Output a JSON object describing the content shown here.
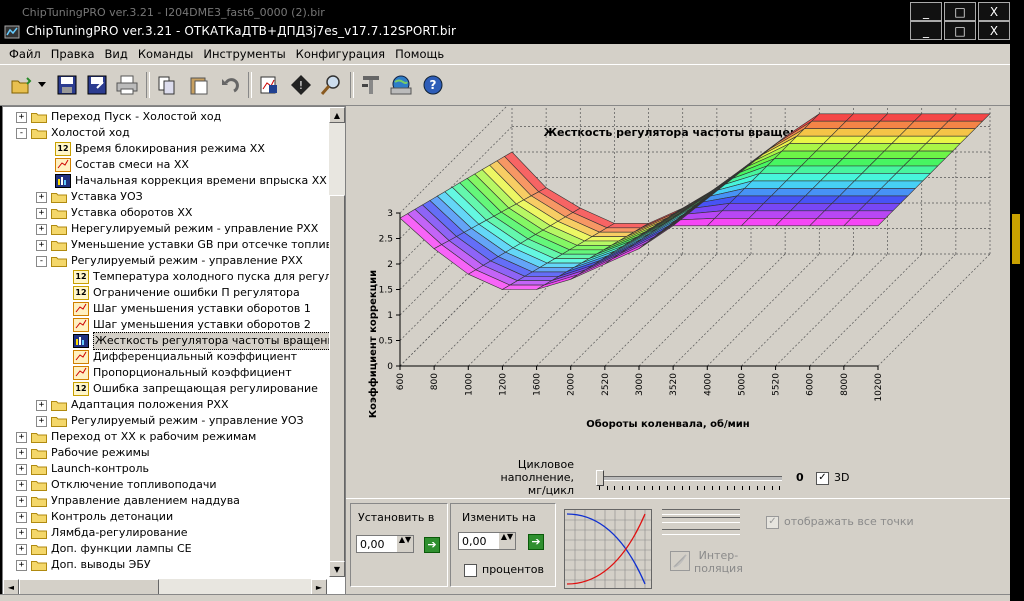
{
  "window": {
    "ghost_title": "ChipTuningPRO ver.3.21 - I204DME3_fast6_0000 (2).bir",
    "title": "ChipTuningPRO ver.3.21 - ОТКАТКаДТВ+ДПДЗj7es_v17.7.12SPORT.bir",
    "buttons": {
      "minimize": "_",
      "maximize": "□",
      "close": "X"
    }
  },
  "menu": [
    "Файл",
    "Правка",
    "Вид",
    "Команды",
    "Инструменты",
    "Конфигурация",
    "Помощь"
  ],
  "toolbar": {
    "icons": [
      "open-icon",
      "save-icon",
      "save-as-icon",
      "print-icon",
      "copy-icon",
      "paste-icon",
      "undo-icon",
      "compare-icon",
      "info-icon",
      "zoom-icon",
      "tools-icon",
      "network-icon",
      "help-icon"
    ]
  },
  "tree": {
    "items": [
      {
        "label": "Переход Пуск - Холостой ход",
        "type": "folder",
        "level": 0,
        "expander": "+"
      },
      {
        "label": "Холостой ход",
        "type": "folder",
        "level": 0,
        "expander": "−"
      },
      {
        "label": "Время блокирования режима ХХ",
        "type": "12",
        "level": 1
      },
      {
        "label": "Состав смеси на ХХ",
        "type": "chart",
        "level": 1
      },
      {
        "label": "Начальная коррекция времени впрыска ХХ",
        "type": "3d",
        "level": 1
      },
      {
        "label": "Уставка УОЗ",
        "type": "folder",
        "level": 1,
        "expander": "+"
      },
      {
        "label": "Уставка оборотов ХХ",
        "type": "folder",
        "level": 1,
        "expander": "+"
      },
      {
        "label": "Нерегулируемый режим - управление РХХ",
        "type": "folder",
        "level": 1,
        "expander": "+"
      },
      {
        "label": "Уменьшение уставки GB при отсечке топливо",
        "type": "folder",
        "level": 1,
        "expander": "+"
      },
      {
        "label": "Регулируемый режим - управление РХХ",
        "type": "folder",
        "level": 1,
        "expander": "−"
      },
      {
        "label": "Температура холодного пуска для регулир",
        "type": "12",
        "level": 2
      },
      {
        "label": "Ограничение ошибки П регулятора",
        "type": "12",
        "level": 2
      },
      {
        "label": "Шаг уменьшения уставки оборотов 1",
        "type": "chart",
        "level": 2
      },
      {
        "label": "Шаг уменьшения уставки оборотов 2",
        "type": "chart",
        "level": 2
      },
      {
        "label": "Жесткость регулятора частоты вращения",
        "type": "3d",
        "level": 2,
        "selected": true
      },
      {
        "label": "Дифференциальный коэффициент",
        "type": "chart",
        "level": 2
      },
      {
        "label": "Пропорциональный коэффициент",
        "type": "chart",
        "level": 2
      },
      {
        "label": "Ошибка запрещающая регулирование",
        "type": "12",
        "level": 2
      },
      {
        "label": "Адаптация положения РХХ",
        "type": "folder",
        "level": 1,
        "expander": "+"
      },
      {
        "label": "Регулируемый режим - управление УОЗ",
        "type": "folder",
        "level": 1,
        "expander": "+"
      },
      {
        "label": "Переход от ХХ к рабочим режимам",
        "type": "folder",
        "level": 0,
        "expander": "+"
      },
      {
        "label": "Рабочие режимы",
        "type": "folder",
        "level": 0,
        "expander": "+"
      },
      {
        "label": "Launch-контроль",
        "type": "folder",
        "level": 0,
        "expander": "+"
      },
      {
        "label": "Отключение топливоподачи",
        "type": "folder",
        "level": 0,
        "expander": "+"
      },
      {
        "label": "Управление давлением наддува",
        "type": "folder",
        "level": 0,
        "expander": "+"
      },
      {
        "label": "Контроль детонации",
        "type": "folder",
        "level": 0,
        "expander": "+"
      },
      {
        "label": "Лямбда-регулирование",
        "type": "folder",
        "level": 0,
        "expander": "+"
      },
      {
        "label": "Доп. функции лампы СЕ",
        "type": "folder",
        "level": 0,
        "expander": "+"
      },
      {
        "label": "Доп. выводы ЭБУ",
        "type": "folder",
        "level": 0,
        "expander": "+"
      }
    ]
  },
  "chart_data": {
    "type": "surface3d",
    "title": "Жесткость регулятора частоты вращения",
    "xlabel": "Обороты коленвала, об/мин",
    "ylabel": "Коэффициент коррекции",
    "x_ticks": [
      "600",
      "800",
      "1000",
      "1200",
      "1600",
      "2000",
      "2520",
      "3000",
      "3520",
      "4000",
      "5000",
      "5520",
      "6000",
      "8000",
      "10200"
    ],
    "z_ticks": [
      "0",
      "0.5",
      "1",
      "1.5",
      "2",
      "2.5",
      "3"
    ],
    "zlim": [
      0,
      3
    ],
    "profile": [
      2.0,
      1.3,
      0.9,
      0.6,
      0.6,
      0.9,
      1.3,
      1.8,
      2.3,
      2.75,
      2.75,
      2.75,
      2.75,
      2.75,
      2.75
    ],
    "front_profile": [
      2.9,
      2.3,
      1.8,
      1.5,
      1.5,
      1.7,
      2.0,
      2.3,
      2.75,
      2.75,
      2.75,
      2.75,
      2.75,
      2.75,
      2.75
    ],
    "rows": 16
  },
  "slider": {
    "label_line1": "Цикловое наполнение,",
    "label_line2": "мг/цикл",
    "value": "0",
    "position_fraction": 0.0,
    "chk_3d_label": "3D",
    "chk_3d_checked": "✓"
  },
  "controls": {
    "set_label": "Установить в",
    "set_value": "0,00",
    "change_label": "Изменить на",
    "change_value": "0,00",
    "percent_label": "процентов",
    "interp_label_1": "Интер-",
    "interp_label_2": "поляция",
    "show_all_points_label": "отображать все точки",
    "show_all_points_check": "✓",
    "go_arrow": "➔",
    "spin": "▲▼"
  },
  "colors": {
    "grid": "#4d4d4d",
    "go": "#2f8f2f"
  }
}
